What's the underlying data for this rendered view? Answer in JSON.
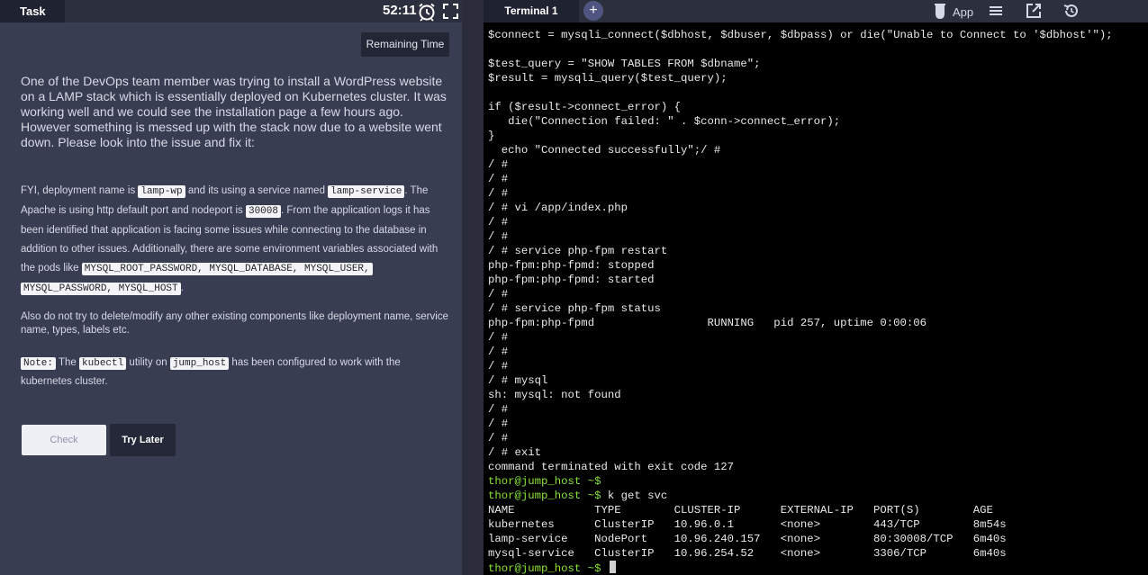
{
  "task": {
    "tab_label": "Task",
    "timer": "52:11",
    "remaining_time_label": "Remaining Time",
    "intro": "One of the DevOps team member was trying to install a WordPress website on a LAMP stack which is essentially deployed on Kubernetes cluster. It was working well and we could see the installation page a few hours ago. However something is messed up with the stack now due to a website went down. Please look into the issue and fix it:",
    "fyi": {
      "t1": "FYI, deployment name is ",
      "c1": "lamp-wp",
      "t2": " and its using a service named ",
      "c2": "lamp-service",
      "t3": ". The Apache is using http default port and nodeport is ",
      "c3": "30008",
      "t4": ". From the application logs it has been identified that application is facing some issues while connecting to the database in addition to other issues. Additionally, there are some environment variables associated with the pods like ",
      "c4": "MYSQL_ROOT_PASSWORD, MYSQL_DATABASE, MYSQL_USER,",
      "c5": "MYSQL_PASSWORD, MYSQL_HOST",
      "t5": "."
    },
    "also": "Also do not try to delete/modify any other existing components like deployment name, service name, types, labels etc.",
    "note": {
      "tag": "Note:",
      "t1": " The ",
      "c1": "kubectl",
      "t2": " utility on ",
      "c2": "jump_host",
      "t3": " has been configured to work with the kubernetes cluster."
    },
    "check_label": "Check",
    "try_later_label": "Try Later"
  },
  "terminal": {
    "tab_label": "Terminal 1",
    "add_tab_label": "+",
    "app_label": "App",
    "lines": [
      {
        "text": "$connect = mysqli_connect($dbhost, $dbuser, $dbpass) or die(\"Unable to Connect to '$dbhost'\");"
      },
      {
        "text": ""
      },
      {
        "text": "$test_query = \"SHOW TABLES FROM $dbname\";"
      },
      {
        "text": "$result = mysqli_query($test_query);"
      },
      {
        "text": ""
      },
      {
        "text": "if ($result->connect_error) {"
      },
      {
        "text": "   die(\"Connection failed: \" . $conn->connect_error);"
      },
      {
        "text": "}"
      },
      {
        "text": "  echo \"Connected successfully\";/ #"
      },
      {
        "text": "/ #"
      },
      {
        "text": "/ #"
      },
      {
        "text": "/ #"
      },
      {
        "text": "/ # vi /app/index.php"
      },
      {
        "text": "/ #"
      },
      {
        "text": "/ #"
      },
      {
        "text": "/ # service php-fpm restart"
      },
      {
        "text": "php-fpm:php-fpmd: stopped"
      },
      {
        "text": "php-fpm:php-fpmd: started"
      },
      {
        "text": "/ #"
      },
      {
        "text": "/ # service php-fpm status"
      },
      {
        "text": "php-fpm:php-fpmd                 RUNNING   pid 257, uptime 0:00:06"
      },
      {
        "text": "/ #"
      },
      {
        "text": "/ #"
      },
      {
        "text": "/ #"
      },
      {
        "text": "/ # mysql"
      },
      {
        "text": "sh: mysql: not found"
      },
      {
        "text": "/ #"
      },
      {
        "text": "/ #"
      },
      {
        "text": "/ #"
      },
      {
        "text": "/ # exit"
      },
      {
        "text": "command terminated with exit code 127"
      },
      {
        "prompt": "thor@jump_host ~$",
        "text": ""
      },
      {
        "prompt": "thor@jump_host ~$",
        "text": " k get svc"
      },
      {
        "text": "NAME            TYPE        CLUSTER-IP      EXTERNAL-IP   PORT(S)        AGE"
      },
      {
        "text": "kubernetes      ClusterIP   10.96.0.1       <none>        443/TCP        8m54s"
      },
      {
        "text": "lamp-service    NodePort    10.96.240.157   <none>        80:30008/TCP   6m40s"
      },
      {
        "text": "mysql-service   ClusterIP   10.96.254.52    <none>        3306/TCP       6m40s"
      },
      {
        "prompt": "thor@jump_host ~$",
        "text": " ",
        "cursor": true
      }
    ]
  },
  "colors": {
    "panel_bg": "#393d52",
    "terminal_bg": "#000000",
    "prompt_green": "#8ae234",
    "stop_red": "#e02f2f"
  }
}
